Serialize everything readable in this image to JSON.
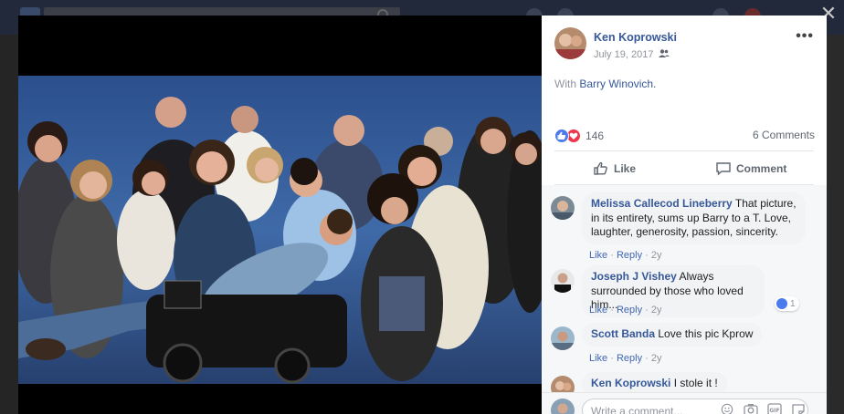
{
  "post": {
    "author": "Ken Koprowski",
    "date": "July 19, 2017",
    "with_prefix": "With",
    "tagged_person": "Barry Winovich.",
    "reaction_count": "146",
    "comments_count": "6 Comments",
    "like_label": "Like",
    "comment_label": "Comment"
  },
  "comments": [
    {
      "author": "Melissa Callecod Lineberry",
      "text": "That picture, in its entirety, sums up Barry to a T. Love, laughter, generosity, passion, sincerity.",
      "like": "Like",
      "reply": "Reply",
      "age": "2y"
    },
    {
      "author": "Joseph J Vishey",
      "text": "Always surrounded by those who loved him...",
      "like": "Like",
      "reply": "Reply",
      "age": "2y",
      "reaction_count": "1"
    },
    {
      "author": "Scott Banda",
      "text": "Love this pic Kprow",
      "like": "Like",
      "reply": "Reply",
      "age": "2y"
    },
    {
      "author": "Ken Koprowski",
      "text": "I stole it !"
    }
  ],
  "composer": {
    "placeholder": "Write a comment..."
  },
  "colors": {
    "link": "#365899",
    "like_blue": "#4b7bec",
    "love_red": "#f0364b"
  }
}
